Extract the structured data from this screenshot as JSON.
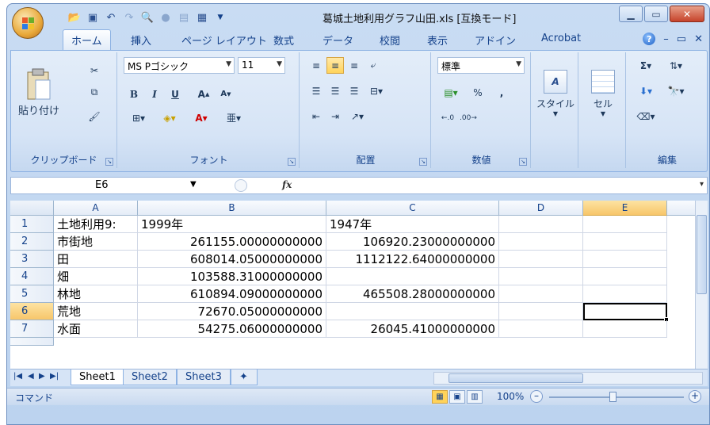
{
  "window": {
    "title": "葛城土地利用グラフ山田.xls [互換モード]"
  },
  "tabs": [
    {
      "label": "ホーム"
    },
    {
      "label": "挿入"
    },
    {
      "label": "ページ レイアウト"
    },
    {
      "label": "数式"
    },
    {
      "label": "データ"
    },
    {
      "label": "校閲"
    },
    {
      "label": "表示"
    },
    {
      "label": "アドイン"
    },
    {
      "label": "Acrobat"
    }
  ],
  "ribbon": {
    "clipboard": {
      "paste_label": "貼り付け",
      "group_label": "クリップボード"
    },
    "font": {
      "font_name": "MS Pゴシック",
      "font_size": "11",
      "group_label": "フォント"
    },
    "alignment": {
      "group_label": "配置"
    },
    "number": {
      "format": "標準",
      "percent": "%",
      "comma": ",",
      "group_label": "数値"
    },
    "styles": {
      "label": "スタイル"
    },
    "cells": {
      "label": "セル"
    },
    "editing": {
      "group_label": "編集"
    }
  },
  "formula_bar": {
    "name_box": "E6",
    "fx": "fx",
    "formula": ""
  },
  "sheet": {
    "columns": [
      "A",
      "B",
      "C",
      "D",
      "E"
    ],
    "rows": [
      {
        "num": "1",
        "A": "土地利用9:",
        "B": "1999年",
        "C": "1947年"
      },
      {
        "num": "2",
        "A": "市街地",
        "B": "261155.00000000000",
        "C": "106920.23000000000"
      },
      {
        "num": "3",
        "A": "田",
        "B": "608014.05000000000",
        "C": "1112122.64000000000"
      },
      {
        "num": "4",
        "A": "畑",
        "B": "103588.31000000000",
        "C": ""
      },
      {
        "num": "5",
        "A": "林地",
        "B": "610894.09000000000",
        "C": "465508.28000000000"
      },
      {
        "num": "6",
        "A": "荒地",
        "B": "72670.05000000000",
        "C": ""
      },
      {
        "num": "7",
        "A": "水面",
        "B": "54275.06000000000",
        "C": "26045.41000000000"
      }
    ],
    "selected_cell": "E6"
  },
  "sheet_tabs": [
    {
      "label": "Sheet1"
    },
    {
      "label": "Sheet2"
    },
    {
      "label": "Sheet3"
    }
  ],
  "status": {
    "mode": "コマンド",
    "zoom": "100%"
  }
}
